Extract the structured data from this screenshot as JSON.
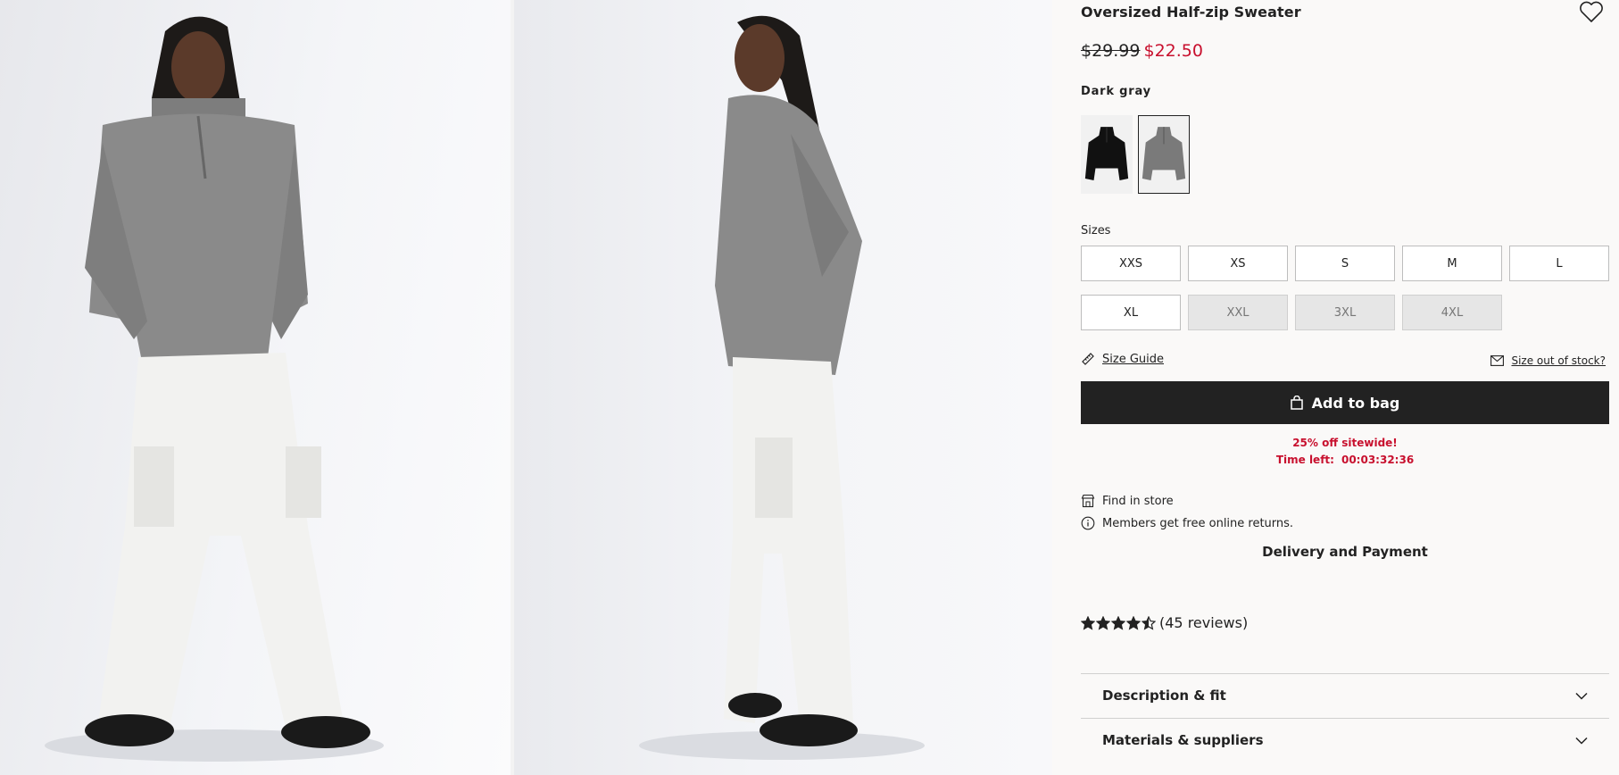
{
  "product": {
    "title": "Oversized Half-zip Sweater",
    "price_original": "$29.99",
    "price_sale": "$22.50",
    "color_selected": "Dark gray",
    "colors": [
      {
        "name": "Black",
        "swatch": "#111111",
        "selected": false
      },
      {
        "name": "Dark gray",
        "swatch": "#7a7a7a",
        "selected": true
      }
    ]
  },
  "sizes": {
    "label": "Sizes",
    "options": [
      {
        "label": "XXS",
        "available": true
      },
      {
        "label": "XS",
        "available": true
      },
      {
        "label": "S",
        "available": true
      },
      {
        "label": "M",
        "available": true
      },
      {
        "label": "L",
        "available": true
      },
      {
        "label": "XL",
        "available": true
      },
      {
        "label": "XXL",
        "available": false
      },
      {
        "label": "3XL",
        "available": false
      },
      {
        "label": "4XL",
        "available": false
      }
    ]
  },
  "links": {
    "size_guide": "Size Guide",
    "size_out_of_stock": "Size out of stock?"
  },
  "actions": {
    "add_to_bag": "Add to bag"
  },
  "promo": {
    "headline": "25% off sitewide!",
    "time_label": "Time left:",
    "time_value": "00:03:32:36"
  },
  "store": {
    "find_in_store": "Find in store",
    "returns_note": "Members get free online returns.",
    "delivery": "Delivery and Payment"
  },
  "reviews": {
    "rating": 4.5,
    "max": 5,
    "text": "(45 reviews)"
  },
  "accordions": [
    {
      "label": "Description & fit"
    },
    {
      "label": "Materials & suppliers"
    }
  ],
  "icons": {
    "favorite": "heart-icon",
    "size_guide": "ruler-icon",
    "notify": "envelope-icon",
    "bag": "bag-icon",
    "store": "store-icon",
    "info": "info-icon",
    "expand": "chevron-down-icon"
  },
  "colors": {
    "sale": "#c8102e",
    "primary_button": "#222222",
    "page_bg": "#faf9f8"
  }
}
